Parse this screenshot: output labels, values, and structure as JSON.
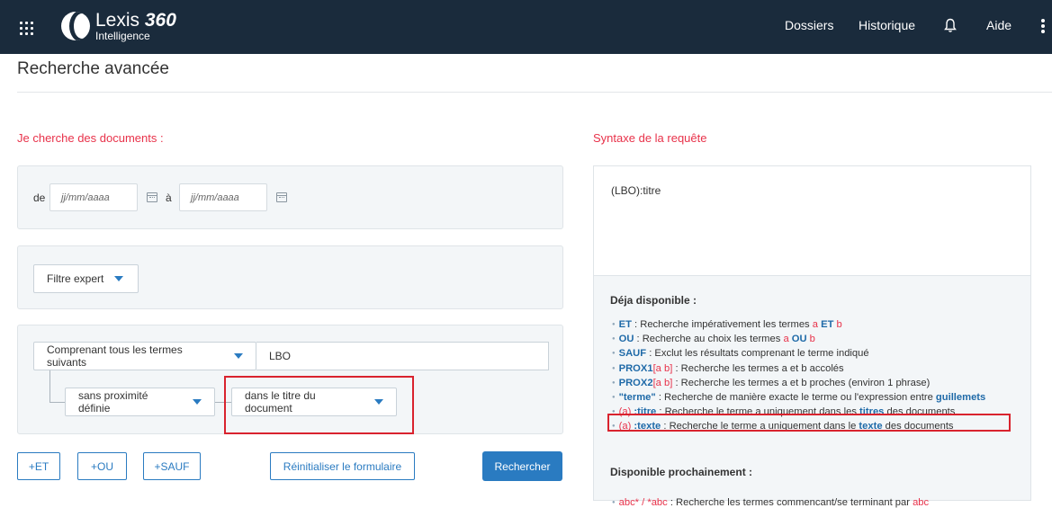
{
  "header": {
    "brand": "Lexis",
    "brand_number": "360",
    "brand_sub": "Intelligence",
    "nav": [
      "Dossiers",
      "Historique",
      "Aide"
    ]
  },
  "page_title": "Recherche avancée",
  "search": {
    "section_title": "Je cherche des documents :",
    "date_from_label": "de",
    "date_from_placeholder": "jj/mm/aaaa",
    "date_to_label": "à",
    "date_to_placeholder": "jj/mm/aaaa",
    "expert_filter": "Filtre expert",
    "criteria_select": "Comprenant tous les termes suivants",
    "criteria_value": "LBO",
    "proximity_select": "sans proximité définie",
    "scope_select": "dans le titre du document"
  },
  "buttons": {
    "and": "+ET",
    "or": "+OU",
    "except": "+SAUF",
    "reset": "Réinitialiser le formulaire",
    "search": "Rechercher"
  },
  "syntax": {
    "section_title": "Syntaxe de la requête",
    "query": "(LBO):titre",
    "available_title": "Déja disponible :",
    "available": [
      {
        "kw": "ET",
        "a": "a",
        "op": "ET",
        "b": "b",
        "prefix": " : Recherche impérativement les termes "
      },
      {
        "kw": "OU",
        "prefix": " : Recherche au choix les termes ",
        "a": "a",
        "op": "OU",
        "b": "b"
      },
      {
        "kw": "SAUF",
        "text": " : Exclut les résultats comprenant le terme indiqué"
      },
      {
        "kw": "PROX1",
        "bracket": "[a b]",
        "text": " : Recherche les termes a et b accolés"
      },
      {
        "kw": "PROX2",
        "bracket": "[a b]",
        "text": " : Recherche les termes a et b proches (environ 1 phrase)"
      },
      {
        "kw": "\"terme\"",
        "text": " : Recherche de manière exacte le terme ou l'expression entre ",
        "tail": "guillemets"
      },
      {
        "pre": "(a)",
        "kw": " :titre",
        "text": " : Recherche le terme a uniquement dans les ",
        "tail": "titres",
        "end": " des documents"
      },
      {
        "pre": "(a)",
        "kw": " :texte",
        "text": " : Recherche le terme a uniquement dans le ",
        "tail": "texte",
        "end": " des documents"
      }
    ],
    "soon_title": "Disponible prochainement :",
    "soon": [
      {
        "abc": "abc* / *abc",
        "text": " : Recherche les termes commencant/se terminant par ",
        "tail": "abc"
      }
    ]
  },
  "colors": {
    "topbar": "#1a2b3c",
    "accent": "#2a7bc1",
    "section_red": "#e8324a",
    "highlight": "#d9232e"
  }
}
